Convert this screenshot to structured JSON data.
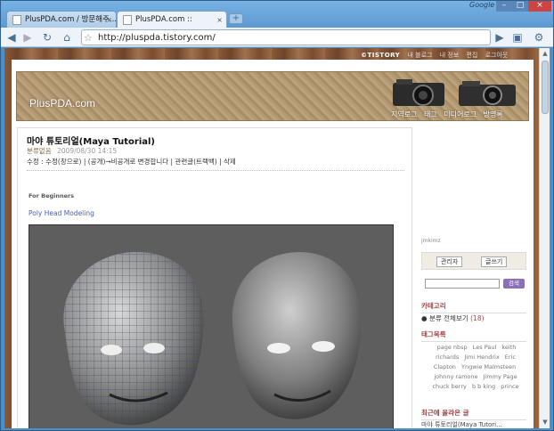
{
  "browser": {
    "tabs": [
      {
        "title": "PlusPDA.com / 방문해주...",
        "active": false
      },
      {
        "title": "PlusPDA.com ::",
        "active": true
      }
    ],
    "google_label": "Google",
    "window_controls": [
      "–",
      "□",
      "×"
    ],
    "url": "http://pluspda.tistory.com/",
    "nav_icons": [
      "back-icon",
      "forward-icon",
      "reload-icon",
      "home-icon"
    ]
  },
  "tistory_bar": {
    "logo": "©TISTORY",
    "items": [
      "내 블로그",
      "내 정보",
      "편집",
      "로그아웃"
    ]
  },
  "blog": {
    "name": "PlusPDA.com",
    "nav": [
      "지역로그",
      "태그",
      "미디어로그",
      "방명록"
    ]
  },
  "post": {
    "title": "마야 튜토리얼(Maya Tutorial)",
    "category": "분류없음",
    "date": "2009/08/30 14:15",
    "actions": "수정 : 수정(창으로) | (공개)→비공개로 변경합니다 | 관련글(트랙백) | 삭제",
    "for_beginners": "For Beginners",
    "link": "Poly Head Modeling"
  },
  "sidebar": {
    "user": "jmkimz",
    "admin_btn": "관리자",
    "write_btn": "글쓰기",
    "search_btn": "검색",
    "category_head": "카테고리",
    "category_item": "분류 전체보기",
    "category_count": "(18)",
    "tag_head": "태그목록",
    "tags": [
      "page nbsp",
      "Les Paul",
      "keith richards",
      "Jimi Hendrix",
      "Eric Clapton",
      "Yngwie Malmsteen",
      "johnny ramone",
      "Jimmy Page",
      "chuck berry",
      "b b king",
      "prince"
    ],
    "recent_head": "최근에 올라온 글",
    "recent_item": "마야 튜토리얼(Maya Tutori..."
  },
  "colors": {
    "chrome_blue": "#5d99d1",
    "banner_tan": "#b39a73",
    "link_blue": "#4a5db0",
    "sidebar_head": "#a04040",
    "search_purple": "#8b6fb8"
  }
}
